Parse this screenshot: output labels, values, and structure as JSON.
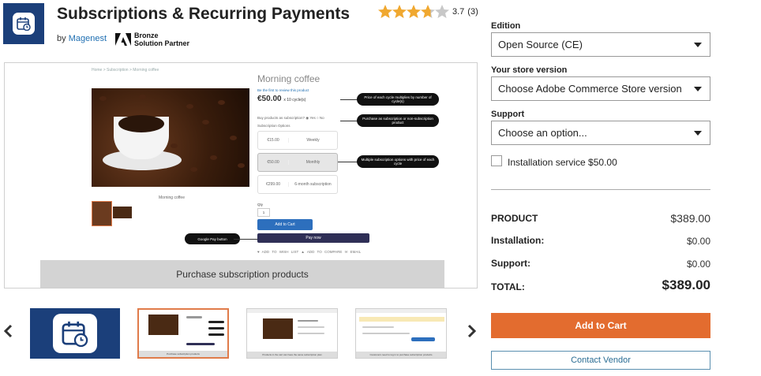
{
  "header": {
    "title": "Subscriptions & Recurring Payments",
    "by_label": "by",
    "vendor": "Magenest",
    "partner_line1": "Bronze",
    "partner_line2": "Solution Partner",
    "rating": "3.7",
    "rating_count": "(3)",
    "rating_value": 3.7,
    "rating_max": 5
  },
  "preview": {
    "breadcrumb": "Home  >  Subscription  >  Morning coffee",
    "product_name": "Morning coffee",
    "review_link": "Be the first to review this product",
    "price": "€50.00",
    "price_suffix": "x 10 cycle(s)",
    "purchase_question": "Buy products as subscription?  ◉ Yes  ○ No",
    "options_label": "Subscription Options",
    "options": [
      {
        "price": "€15.00",
        "label": "Weekly"
      },
      {
        "price": "€50.00",
        "label": "Monthly"
      },
      {
        "price": "€299.00",
        "label": "6-month subscription"
      }
    ],
    "image_caption": "Morning coffee",
    "qty_label": "Qty",
    "qty_value": "1",
    "add_to_cart": "Add to Cart",
    "pay_now": "Pay now",
    "links": "♥ ADD TO WISH LIST   ▲ ADD TO COMPARE   ✉ EMAIL",
    "callout_price": "Price of each cycle multiplies by number of cycle(s)",
    "callout_purchase": "Purchase as subscription or non-subscription product",
    "callout_multiple": "Multiple subscription options with price of each cycle",
    "callout_gpay": "Google Pay button",
    "banner": "Purchase subscription products"
  },
  "thumbnails": {
    "prev_icon": "chevron-left-icon",
    "next_icon": "chevron-right-icon",
    "captions": [
      "",
      "Purchase subscription products",
      "Products in the cart can have the same subscription plan",
      "Customers need to log in to purchase subscription products"
    ]
  },
  "panel": {
    "edition_label": "Edition",
    "edition_value": "Open Source (CE)",
    "store_label": "Your store version",
    "store_value": "Choose Adobe Commerce Store version",
    "support_label": "Support",
    "support_value": "Choose an option...",
    "install_label": "Installation service $50.00",
    "install_checked": false,
    "product_label": "PRODUCT",
    "product_value": "$389.00",
    "installation_label": "Installation:",
    "installation_value": "$0.00",
    "support_sum_label": "Support:",
    "support_sum_value": "$0.00",
    "total_label": "TOTAL:",
    "total_value": "$389.00",
    "add_to_cart": "Add to Cart",
    "contact_vendor": "Contact Vendor"
  },
  "colors": {
    "accent": "#e36c2f",
    "brand_blue": "#1b3f7a",
    "link": "#1f6fb2",
    "star": "#f0a830"
  }
}
